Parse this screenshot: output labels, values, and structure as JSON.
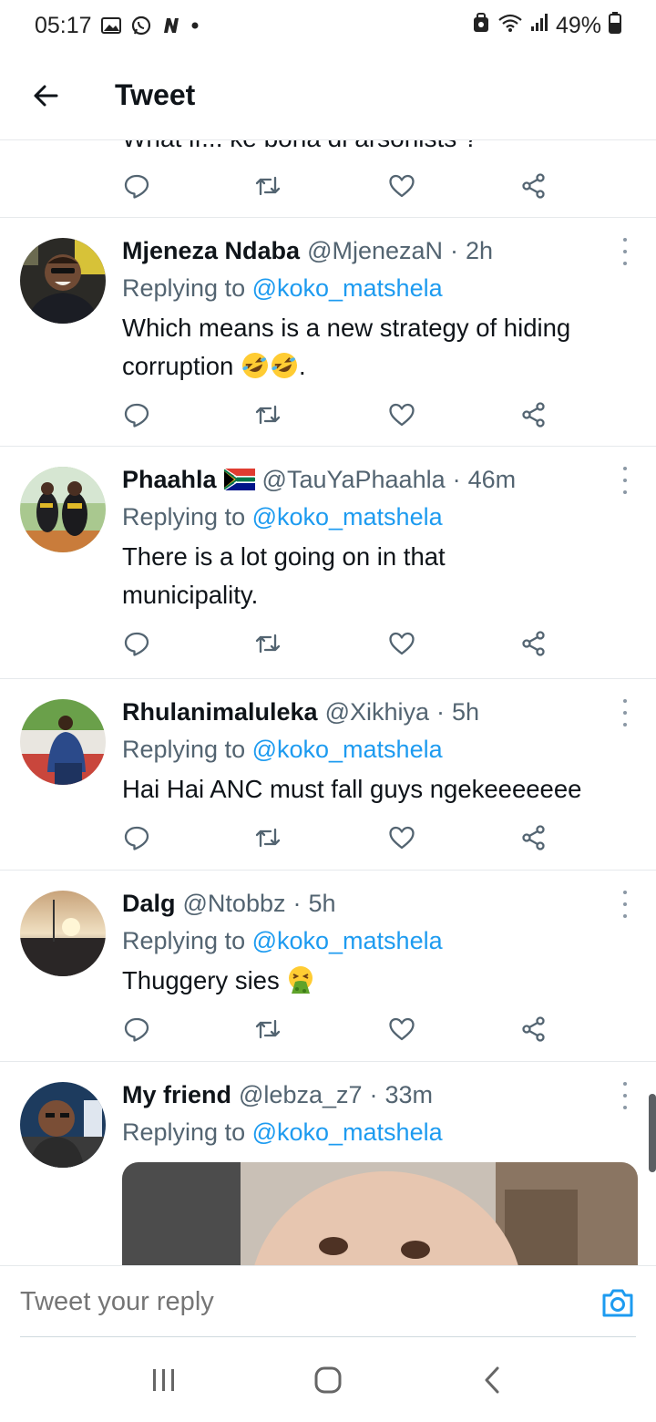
{
  "status_bar": {
    "time": "05:17",
    "battery": "49%",
    "left_icons": [
      "gallery-icon",
      "whatsapp-icon",
      "news-icon",
      "dot-icon"
    ],
    "right_icons": [
      "bixby-icon",
      "wifi-icon",
      "signal-icon",
      "battery-icon"
    ]
  },
  "header": {
    "title": "Tweet",
    "back_icon": "back-arrow-icon"
  },
  "clipped_tweet": {
    "text": "What if... ke bona di arsonists ?"
  },
  "actions_icons": [
    "reply-icon",
    "retweet-icon",
    "like-icon",
    "share-icon"
  ],
  "tweets": [
    {
      "name": "Mjeneza Ndaba",
      "handle": "@MjenezaN",
      "dot": "·",
      "time": "2h",
      "replying_prefix": "Replying to ",
      "replying_to": "@koko_matshela",
      "text": "Which means is a new strategy of hiding corruption",
      "text_suffix": ".",
      "emojis": [
        "rolling-laughing-emoji",
        "rolling-laughing-emoji"
      ]
    },
    {
      "name": "Phaahla",
      "flag": "south-africa-flag",
      "handle": "@TauYaPhaahla",
      "dot": "·",
      "time": "46m",
      "replying_prefix": "Replying to ",
      "replying_to": "@koko_matshela",
      "text": "There is a lot going on in that municipality."
    },
    {
      "name": "Rhulanimaluleka",
      "handle": "@Xikhiya",
      "dot": "·",
      "time": "5h",
      "replying_prefix": "Replying to ",
      "replying_to": "@koko_matshela",
      "text": "Hai Hai ANC must fall guys ngekeeeeeee"
    },
    {
      "name": "Dalg",
      "handle": "@Ntobbz",
      "dot": "·",
      "time": "5h",
      "replying_prefix": "Replying to ",
      "replying_to": "@koko_matshela",
      "text": "Thuggery sies",
      "emojis": [
        "vomiting-face-emoji"
      ]
    },
    {
      "name": "My friend",
      "handle": "@lebza_z7",
      "dot": "·",
      "time": "33m",
      "replying_prefix": "Replying to ",
      "replying_to": "@koko_matshela",
      "media": "baby-photo"
    }
  ],
  "reply_bar": {
    "placeholder": "Tweet your reply",
    "camera_icon": "camera-icon"
  },
  "nav_bar": {
    "icons": [
      "recent-apps-icon",
      "home-icon",
      "back-icon"
    ]
  },
  "colors": {
    "accent": "#1d9bf0",
    "text": "#0f1419",
    "secondary_text": "#536471",
    "divider": "#e6e9ec"
  }
}
